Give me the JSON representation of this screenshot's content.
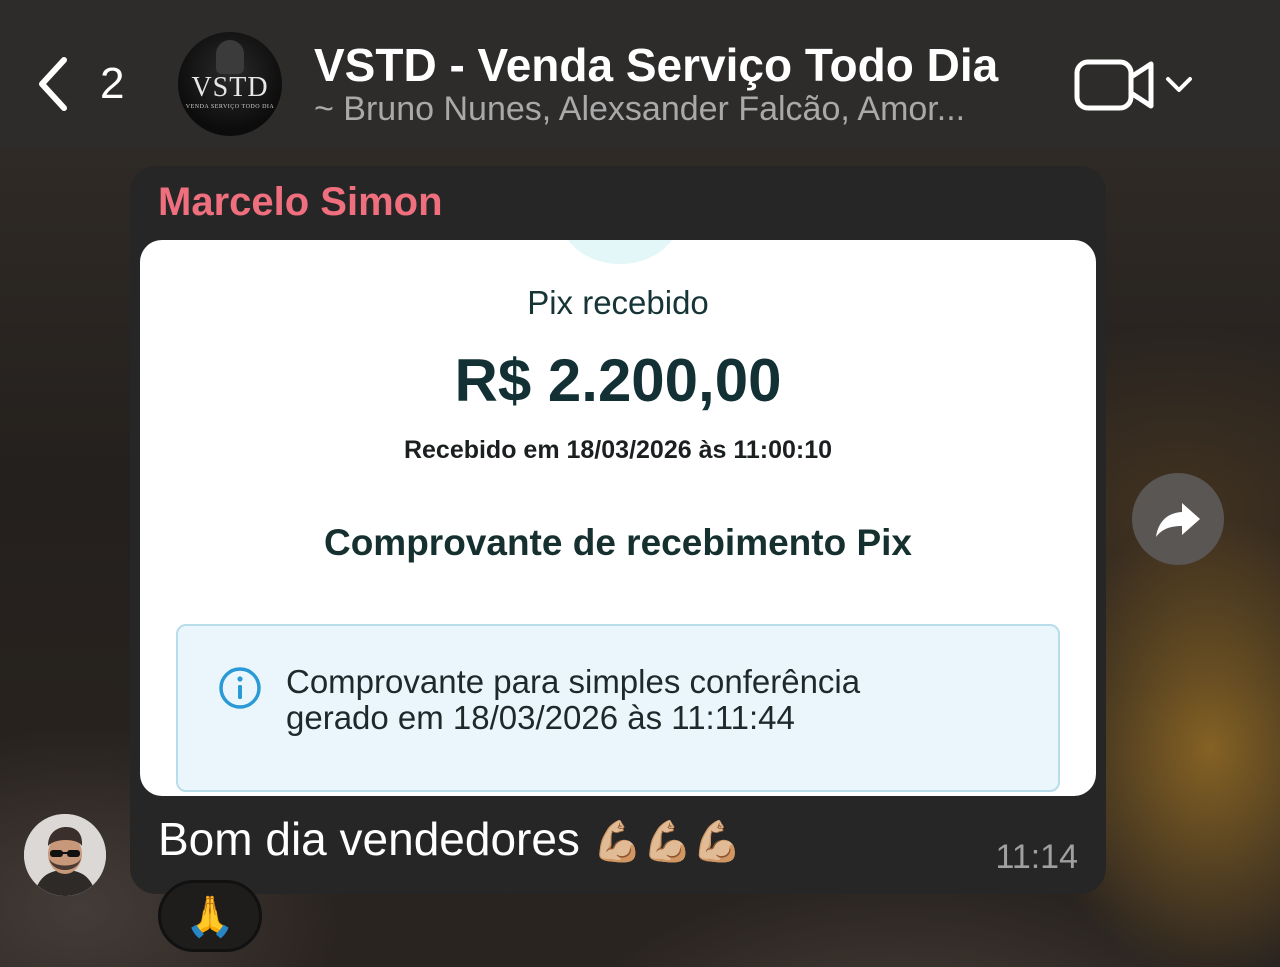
{
  "header": {
    "back_count": "2",
    "group_title": "VSTD - Venda Serviço Todo Dia",
    "group_members": "~ Bruno Nunes, Alexsander Falcão, Amor...",
    "avatar_logo": "VSTD",
    "avatar_logo_sub": "VENDA SERVIÇO TODO DIA"
  },
  "message": {
    "sender": "Marcelo Simon",
    "text": "Bom dia vendedores",
    "emojis": "💪🏼💪🏼💪🏼",
    "time": "11:14",
    "reaction": "🙏"
  },
  "receipt": {
    "title": "Pix recebido",
    "amount": "R$ 2.200,00",
    "received_at": "Recebido em 18/03/2026 às 11:00:10",
    "comprovante_title": "Comprovante de recebimento Pix",
    "info_line1": "Comprovante para simples conferência",
    "info_line2": "gerado em 18/03/2026 às 11:11:44"
  },
  "colors": {
    "header_bg": "#2d2c2b",
    "bubble_bg": "#262626",
    "sender_name": "#f06f7e",
    "info_accent": "#2a9ad6"
  },
  "icons": [
    "chevron-left-icon",
    "video-camera-icon",
    "chevron-down-icon",
    "forward-icon",
    "info-icon"
  ]
}
